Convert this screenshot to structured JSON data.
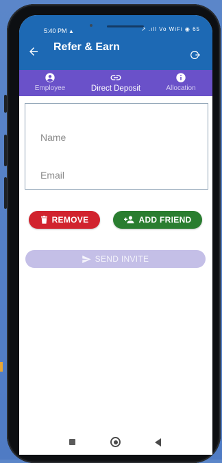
{
  "status_bar": {
    "time": "5:40 PM",
    "time_icon": "warning-icon",
    "icons_text": "↗ .ıll Vo WiFi ◉ 65"
  },
  "header": {
    "title": "Refer & Earn",
    "back_icon": "arrow-left-icon",
    "exit_icon": "logout-icon"
  },
  "tabs": [
    {
      "label": "Employee",
      "icon": "person-icon",
      "active": false
    },
    {
      "label": "Direct Deposit",
      "icon": "link-icon",
      "active": true
    },
    {
      "label": "Allocation",
      "icon": "info-icon",
      "active": false
    }
  ],
  "form": {
    "name_placeholder": "Name",
    "name_value": "",
    "email_placeholder": "Email",
    "email_value": ""
  },
  "actions": {
    "remove_label": "REMOVE",
    "add_friend_label": "ADD FRIEND",
    "send_invite_label": "SEND INVITE"
  },
  "colors": {
    "app_bar": "#1d69b4",
    "tab_bar": "#6a51c9",
    "remove": "#d1232e",
    "add_friend": "#2a7d30",
    "send_invite_disabled": "#c4bfe7"
  }
}
